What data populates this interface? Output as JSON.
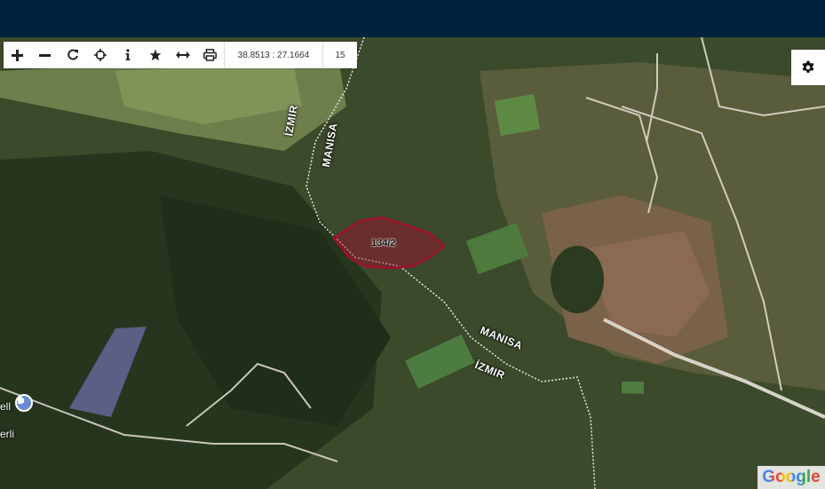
{
  "toolbar": {
    "buttons": [
      {
        "name": "zoom-in-button",
        "icon": "plus-icon"
      },
      {
        "name": "zoom-out-button",
        "icon": "minus-icon"
      },
      {
        "name": "refresh-button",
        "icon": "refresh-icon"
      },
      {
        "name": "locate-button",
        "icon": "crosshair-icon"
      },
      {
        "name": "info-button",
        "icon": "info-icon"
      },
      {
        "name": "favorite-button",
        "icon": "star-icon"
      },
      {
        "name": "measure-button",
        "icon": "measure-icon"
      },
      {
        "name": "print-button",
        "icon": "print-icon"
      }
    ],
    "coordinates": "38.8513 : 27.1664",
    "zoom_level": "15"
  },
  "map": {
    "parcel_label": "134/2",
    "border_labels": [
      "İZMIR",
      "MANISA",
      "MANISA",
      "İZMIR"
    ],
    "town_labels": [
      "ell",
      "erli"
    ],
    "parcel_color": "#a0102e",
    "google_logo": "Google"
  }
}
